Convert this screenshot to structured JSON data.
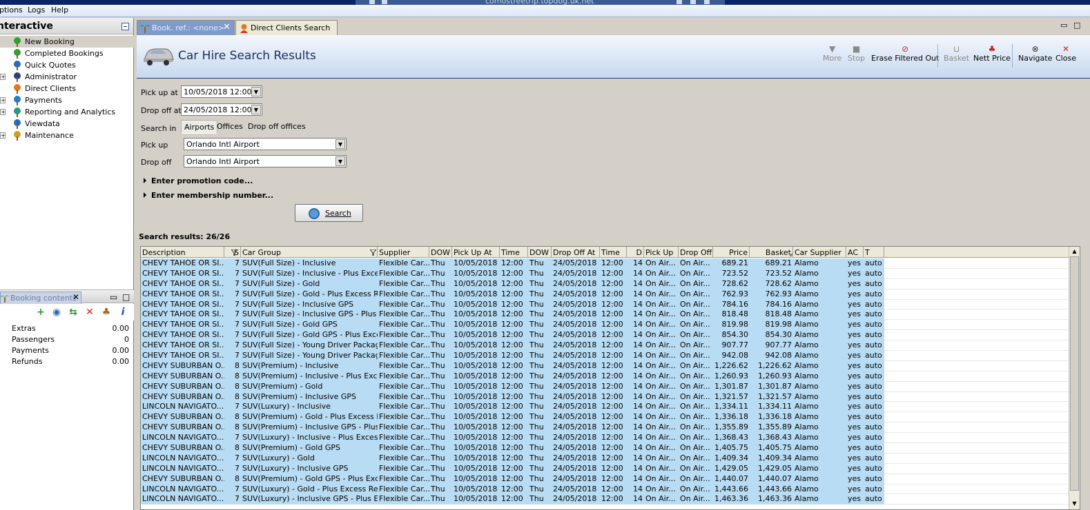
{
  "menubar": {
    "items": [
      "ptions",
      "Logs",
      "Help"
    ]
  },
  "remote_host": "comostreetrip.topdog.uk.net",
  "left": {
    "title": "nteractive",
    "tree": [
      {
        "label": "New Booking",
        "icon": "palm-tree-icon",
        "expandable": false,
        "selected": true
      },
      {
        "label": "Completed Bookings",
        "icon": "palm-tree-icon",
        "expandable": false
      },
      {
        "label": "Quick Quotes",
        "icon": "globe-icon",
        "expandable": false
      },
      {
        "label": "Administrator",
        "icon": "person-icon",
        "expandable": true
      },
      {
        "label": "Direct Clients",
        "icon": "star-user-icon",
        "expandable": false
      },
      {
        "label": "Payments",
        "icon": "payment-icon",
        "expandable": true
      },
      {
        "label": "Reporting and Analytics",
        "icon": "report-icon",
        "expandable": true
      },
      {
        "label": "Viewdata",
        "icon": "globe-icon",
        "expandable": false
      },
      {
        "label": "Maintenance",
        "icon": "box-icon",
        "expandable": true
      }
    ],
    "booking": {
      "tab_label": "Booking contents",
      "rows": [
        {
          "label": "Extras",
          "value": "0.00"
        },
        {
          "label": "Passengers",
          "value": "0"
        },
        {
          "label": "Payments",
          "value": "0.00"
        },
        {
          "label": "Refunds",
          "value": "0.00"
        }
      ]
    }
  },
  "tabs": [
    {
      "label": "Book. ref.: <none>",
      "active": true
    },
    {
      "label": "Direct Clients Search",
      "active": false
    }
  ],
  "header": {
    "title": "Car Hire Search Results",
    "buttons": [
      {
        "label": "More",
        "enabled": false
      },
      {
        "label": "Stop",
        "enabled": false
      },
      {
        "label": "Erase Filtered Out",
        "enabled": true
      },
      {
        "label": "Basket",
        "enabled": false
      },
      {
        "label": "Nett Price",
        "enabled": true
      },
      {
        "label": "Navigate",
        "enabled": true
      },
      {
        "label": "Close",
        "enabled": true
      }
    ]
  },
  "form": {
    "pickup_at_label": "Pick up at",
    "pickup_at": "10/05/2018 12:00",
    "dropoff_at_label": "Drop off at",
    "dropoff_at": "24/05/2018 12:00",
    "search_in_label": "Search in",
    "search_in_options": [
      "Airports",
      "Offices",
      "Drop off offices"
    ],
    "search_in_selected": "Airports",
    "pickup_label": "Pick up",
    "pickup": "Orlando Intl Airport",
    "dropoff_label": "Drop off",
    "dropoff": "Orlando Intl Airport",
    "promo_label": "Enter promotion code...",
    "membership_label": "Enter membership number...",
    "search_button": "Search"
  },
  "results": {
    "count_label": "Search results: 26/26",
    "columns": [
      "Description",
      "S",
      "Car Group",
      "Supplier",
      "DOW",
      "Pick Up At",
      "Time",
      "DOW",
      "Drop Off At",
      "Time",
      "D",
      "Pick Up",
      "Drop Off",
      "Price",
      "Basket",
      "Car Supplier",
      "AC",
      "T"
    ],
    "rows": [
      [
        "CHEVY TAHOE OR SI...",
        "7",
        "SUV(Full Size) - Inclusive",
        "Flexible Car...",
        "Thu",
        "10/05/2018",
        "12:00",
        "Thu",
        "24/05/2018",
        "12:00",
        "14",
        "On Air...",
        "On Air...",
        "689.21",
        "689.21",
        "Alamo",
        "yes",
        "auto"
      ],
      [
        "CHEVY TAHOE OR SI...",
        "7",
        "SUV(Full Size) - Inclusive - Plus Excess...",
        "Flexible Car...",
        "Thu",
        "10/05/2018",
        "12:00",
        "Thu",
        "24/05/2018",
        "12:00",
        "14",
        "On Air...",
        "On Air...",
        "723.52",
        "723.52",
        "Alamo",
        "yes",
        "auto"
      ],
      [
        "CHEVY TAHOE OR SI...",
        "7",
        "SUV(Full Size) - Gold",
        "Flexible Car...",
        "Thu",
        "10/05/2018",
        "12:00",
        "Thu",
        "24/05/2018",
        "12:00",
        "14",
        "On Air...",
        "On Air...",
        "728.62",
        "728.62",
        "Alamo",
        "yes",
        "auto"
      ],
      [
        "CHEVY TAHOE OR SI...",
        "7",
        "SUV(Full Size) - Gold - Plus Excess Ref...",
        "Flexible Car...",
        "Thu",
        "10/05/2018",
        "12:00",
        "Thu",
        "24/05/2018",
        "12:00",
        "14",
        "On Air...",
        "On Air...",
        "762.93",
        "762.93",
        "Alamo",
        "yes",
        "auto"
      ],
      [
        "CHEVY TAHOE OR SI...",
        "7",
        "SUV(Full Size) - Inclusive GPS",
        "Flexible Car...",
        "Thu",
        "10/05/2018",
        "12:00",
        "Thu",
        "24/05/2018",
        "12:00",
        "14",
        "On Air...",
        "On Air...",
        "784.16",
        "784.16",
        "Alamo",
        "yes",
        "auto"
      ],
      [
        "CHEVY TAHOE OR SI...",
        "7",
        "SUV(Full Size) - Inclusive GPS - Plus E...",
        "Flexible Car...",
        "Thu",
        "10/05/2018",
        "12:00",
        "Thu",
        "24/05/2018",
        "12:00",
        "14",
        "On Air...",
        "On Air...",
        "818.48",
        "818.48",
        "Alamo",
        "yes",
        "auto"
      ],
      [
        "CHEVY TAHOE OR SI...",
        "7",
        "SUV(Full Size) - Gold GPS",
        "Flexible Car...",
        "Thu",
        "10/05/2018",
        "12:00",
        "Thu",
        "24/05/2018",
        "12:00",
        "14",
        "On Air...",
        "On Air...",
        "819.98",
        "819.98",
        "Alamo",
        "yes",
        "auto"
      ],
      [
        "CHEVY TAHOE OR SI...",
        "7",
        "SUV(Full Size) - Gold GPS - Plus Exces...",
        "Flexible Car...",
        "Thu",
        "10/05/2018",
        "12:00",
        "Thu",
        "24/05/2018",
        "12:00",
        "14",
        "On Air...",
        "On Air...",
        "854.30",
        "854.30",
        "Alamo",
        "yes",
        "auto"
      ],
      [
        "CHEVY TAHOE OR SI...",
        "7",
        "SUV(Full Size) - Young Driver Package...",
        "Flexible Car...",
        "Thu",
        "10/05/2018",
        "12:00",
        "Thu",
        "24/05/2018",
        "12:00",
        "14",
        "On Air...",
        "On Air...",
        "907.77",
        "907.77",
        "Alamo",
        "yes",
        "auto"
      ],
      [
        "CHEVY TAHOE OR SI...",
        "7",
        "SUV(Full Size) - Young Driver Package...",
        "Flexible Car...",
        "Thu",
        "10/05/2018",
        "12:00",
        "Thu",
        "24/05/2018",
        "12:00",
        "14",
        "On Air...",
        "On Air...",
        "942.08",
        "942.08",
        "Alamo",
        "yes",
        "auto"
      ],
      [
        "CHEVY SUBURBAN O...",
        "8",
        "SUV(Premium) - Inclusive",
        "Flexible Car...",
        "Thu",
        "10/05/2018",
        "12:00",
        "Thu",
        "24/05/2018",
        "12:00",
        "14",
        "On Air...",
        "On Air...",
        "1,226.62",
        "1,226.62",
        "Alamo",
        "yes",
        "auto"
      ],
      [
        "CHEVY SUBURBAN O...",
        "8",
        "SUV(Premium) - Inclusive - Plus Exces...",
        "Flexible Car...",
        "Thu",
        "10/05/2018",
        "12:00",
        "Thu",
        "24/05/2018",
        "12:00",
        "14",
        "On Air...",
        "On Air...",
        "1,260.93",
        "1,260.93",
        "Alamo",
        "yes",
        "auto"
      ],
      [
        "CHEVY SUBURBAN O...",
        "8",
        "SUV(Premium) - Gold",
        "Flexible Car...",
        "Thu",
        "10/05/2018",
        "12:00",
        "Thu",
        "24/05/2018",
        "12:00",
        "14",
        "On Air...",
        "On Air...",
        "1,301.87",
        "1,301.87",
        "Alamo",
        "yes",
        "auto"
      ],
      [
        "CHEVY SUBURBAN O...",
        "8",
        "SUV(Premium) - Inclusive GPS",
        "Flexible Car...",
        "Thu",
        "10/05/2018",
        "12:00",
        "Thu",
        "24/05/2018",
        "12:00",
        "14",
        "On Air...",
        "On Air...",
        "1,321.57",
        "1,321.57",
        "Alamo",
        "yes",
        "auto"
      ],
      [
        "LINCOLN NAVIGATO...",
        "7",
        "SUV(Luxury) - Inclusive",
        "Flexible Car...",
        "Thu",
        "10/05/2018",
        "12:00",
        "Thu",
        "24/05/2018",
        "12:00",
        "14",
        "On Air...",
        "On Air...",
        "1,334.11",
        "1,334.11",
        "Alamo",
        "yes",
        "auto"
      ],
      [
        "CHEVY SUBURBAN O...",
        "8",
        "SUV(Premium) - Gold - Plus Excess Re...",
        "Flexible Car...",
        "Thu",
        "10/05/2018",
        "12:00",
        "Thu",
        "24/05/2018",
        "12:00",
        "14",
        "On Air...",
        "On Air...",
        "1,336.18",
        "1,336.18",
        "Alamo",
        "yes",
        "auto"
      ],
      [
        "CHEVY SUBURBAN O...",
        "8",
        "SUV(Premium) - Inclusive GPS - Plus E...",
        "Flexible Car...",
        "Thu",
        "10/05/2018",
        "12:00",
        "Thu",
        "24/05/2018",
        "12:00",
        "14",
        "On Air...",
        "On Air...",
        "1,355.89",
        "1,355.89",
        "Alamo",
        "yes",
        "auto"
      ],
      [
        "LINCOLN NAVIGATO...",
        "7",
        "SUV(Luxury) - Inclusive - Plus Excess ...",
        "Flexible Car...",
        "Thu",
        "10/05/2018",
        "12:00",
        "Thu",
        "24/05/2018",
        "12:00",
        "14",
        "On Air...",
        "On Air...",
        "1,368.43",
        "1,368.43",
        "Alamo",
        "yes",
        "auto"
      ],
      [
        "CHEVY SUBURBAN O...",
        "8",
        "SUV(Premium) - Gold GPS",
        "Flexible Car...",
        "Thu",
        "10/05/2018",
        "12:00",
        "Thu",
        "24/05/2018",
        "12:00",
        "14",
        "On Air...",
        "On Air...",
        "1,405.75",
        "1,405.75",
        "Alamo",
        "yes",
        "auto"
      ],
      [
        "LINCOLN NAVIGATO...",
        "7",
        "SUV(Luxury) - Gold",
        "Flexible Car...",
        "Thu",
        "10/05/2018",
        "12:00",
        "Thu",
        "24/05/2018",
        "12:00",
        "14",
        "On Air...",
        "On Air...",
        "1,409.34",
        "1,409.34",
        "Alamo",
        "yes",
        "auto"
      ],
      [
        "LINCOLN NAVIGATO...",
        "7",
        "SUV(Luxury) - Inclusive GPS",
        "Flexible Car...",
        "Thu",
        "10/05/2018",
        "12:00",
        "Thu",
        "24/05/2018",
        "12:00",
        "14",
        "On Air...",
        "On Air...",
        "1,429.05",
        "1,429.05",
        "Alamo",
        "yes",
        "auto"
      ],
      [
        "CHEVY SUBURBAN O...",
        "8",
        "SUV(Premium) - Gold GPS - Plus Exces...",
        "Flexible Car...",
        "Thu",
        "10/05/2018",
        "12:00",
        "Thu",
        "24/05/2018",
        "12:00",
        "14",
        "On Air...",
        "On Air...",
        "1,440.07",
        "1,440.07",
        "Alamo",
        "yes",
        "auto"
      ],
      [
        "LINCOLN NAVIGATO...",
        "7",
        "SUV(Luxury) - Gold - Plus Excess Refund",
        "Flexible Car...",
        "Thu",
        "10/05/2018",
        "12:00",
        "Thu",
        "24/05/2018",
        "12:00",
        "14",
        "On Air...",
        "On Air...",
        "1,443.66",
        "1,443.66",
        "Alamo",
        "yes",
        "auto"
      ],
      [
        "LINCOLN NAVIGATO...",
        "7",
        "SUV(Luxury) - Inclusive GPS - Plus Ex...",
        "Flexible Car...",
        "Thu",
        "10/05/2018",
        "12:00",
        "Thu",
        "24/05/2018",
        "12:00",
        "14",
        "On Air...",
        "On Air...",
        "1,463.36",
        "1,463.36",
        "Alamo",
        "yes",
        "auto"
      ]
    ]
  },
  "colors": {
    "row_highlight": "#b8dcf4",
    "tab_active": "#7e9bc9",
    "title_text": "#1a2c5a",
    "close_red": "#d22020"
  }
}
